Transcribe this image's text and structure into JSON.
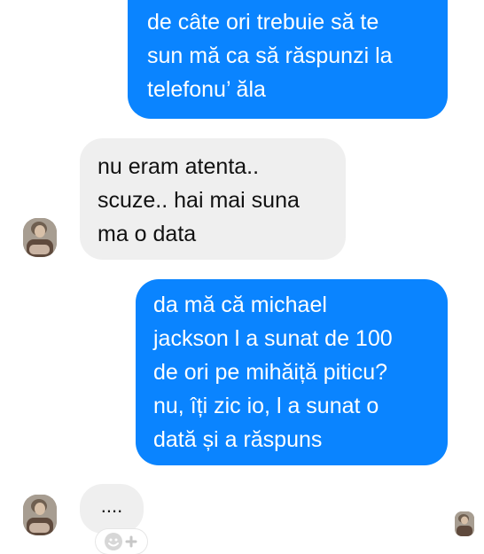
{
  "conversation": {
    "messages": [
      {
        "sender": "me",
        "text": "de câte ori trebuie să te\nsun mă ca să răspunzi la\ntelefonu’ ăla"
      },
      {
        "sender": "other",
        "text": "nu eram atenta..\nscuze.. hai mai suna\nma o data"
      },
      {
        "sender": "me",
        "text": "da mă că michael\njackson l a sunat de 100\nde ori pe mihăiță piticu?\nnu, îți zic io, l a sunat o\ndată și a răspuns"
      },
      {
        "sender": "other",
        "text": "...."
      }
    ]
  },
  "icons": {
    "avatar": "contact-avatar-icon",
    "read_receipt": "seen-avatar-icon",
    "reaction": "add-reaction-icon"
  },
  "colors": {
    "outgoing_bubble": "#0a84ff",
    "incoming_bubble": "#efefef",
    "background": "#ffffff"
  }
}
